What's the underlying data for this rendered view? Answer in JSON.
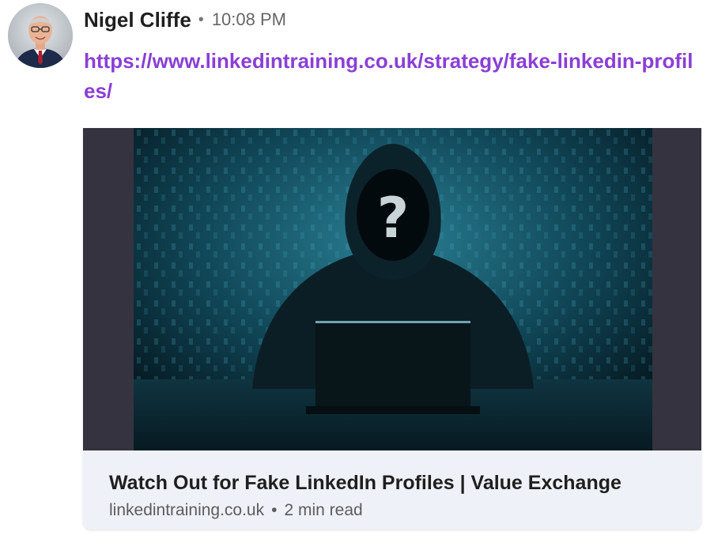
{
  "message": {
    "sender": "Nigel Cliffe",
    "separator": "•",
    "time": "10:08 PM",
    "link_text": "https://www.linkedintraining.co.uk/strategy/fake-linkedin-profiles/"
  },
  "link_preview": {
    "title": "Watch Out for Fake LinkedIn Profiles | Value Exchange",
    "domain": "linkedintraining.co.uk",
    "meta_separator": "•",
    "read_time": "2 min read",
    "image_icon": "hooded-figure-question-mark"
  },
  "colors": {
    "link": "#8a3fd6",
    "card_background": "#eef1f7",
    "image_letterbox": "#35333f"
  }
}
